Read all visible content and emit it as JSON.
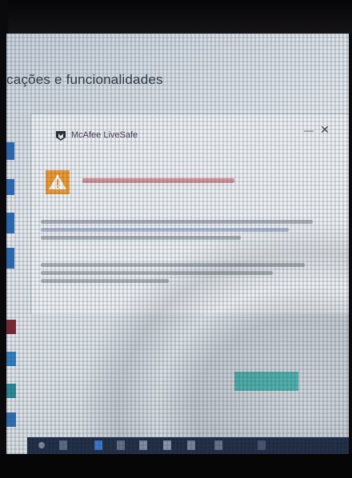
{
  "page": {
    "heading": "cações e funcionalidades"
  },
  "popup": {
    "brand_title": "McAfee LiveSafe",
    "minimize_glyph": "—",
    "close_glyph": "✕",
    "warning_icon": "warning-triangle-icon",
    "brand_icon": "mcafee-shield-icon"
  },
  "colors": {
    "brand_red": "#c8102e",
    "warning_orange": "#f29a2e",
    "action_teal": "#4fb8b4",
    "taskbar_navy": "#1d2a44"
  },
  "taskbar": {
    "icons": [
      "search-icon",
      "task-view-icon",
      "edge-icon",
      "store-icon",
      "file-explorer-icon",
      "mail-icon",
      "photos-icon",
      "people-icon",
      "settings-icon"
    ]
  }
}
